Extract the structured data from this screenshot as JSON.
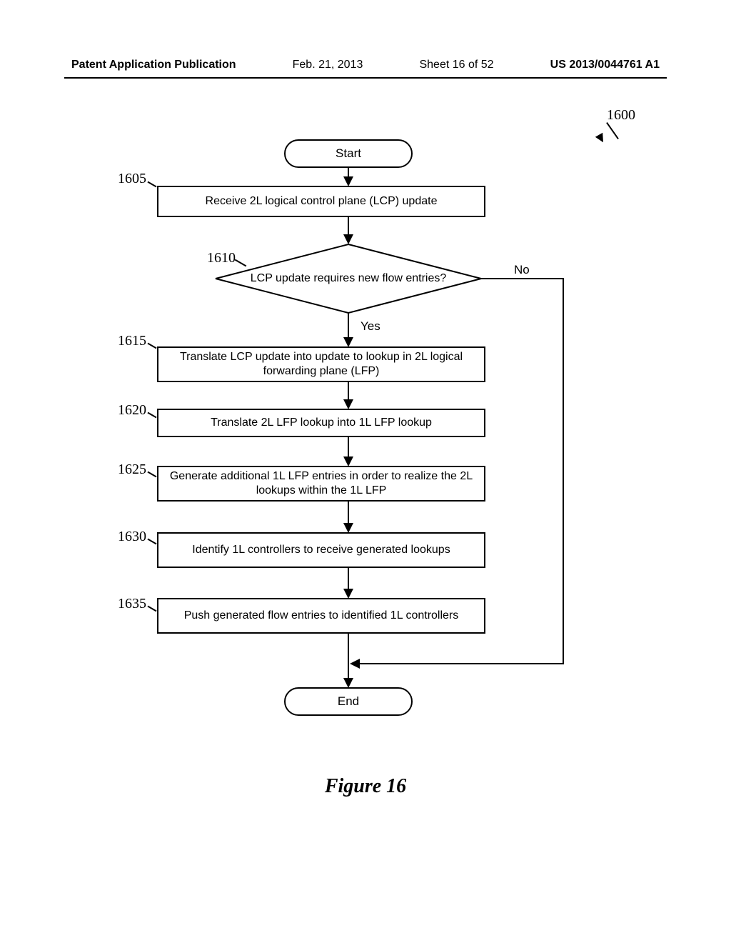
{
  "header": {
    "publication": "Patent Application Publication",
    "date": "Feb. 21, 2013",
    "sheet": "Sheet 16 of 52",
    "pub_id": "US 2013/0044761 A1"
  },
  "figure_caption": "Figure 16",
  "refs": {
    "r1600": "1600",
    "r1605": "1605",
    "r1610": "1610",
    "r1615": "1615",
    "r1620": "1620",
    "r1625": "1625",
    "r1630": "1630",
    "r1635": "1635"
  },
  "labels": {
    "start": "Start",
    "end": "End",
    "yes": "Yes",
    "no": "No"
  },
  "steps": {
    "s1605": "Receive 2L logical control plane (LCP) update",
    "s1610": "LCP update requires new flow entries?",
    "s1615": "Translate LCP update into update to lookup in 2L logical forwarding plane (LFP)",
    "s1620": "Translate 2L LFP lookup into 1L LFP lookup",
    "s1625": "Generate additional 1L LFP entries in order to realize the 2L lookups within the 1L LFP",
    "s1630": "Identify 1L controllers to receive generated lookups",
    "s1635": "Push generated flow entries to identified 1L controllers"
  },
  "chart_data": {
    "type": "flowchart",
    "title": "Figure 16",
    "ref": "1600",
    "nodes": [
      {
        "id": "start",
        "type": "terminator",
        "label": "Start"
      },
      {
        "id": "1605",
        "type": "process",
        "label": "Receive 2L logical control plane (LCP) update"
      },
      {
        "id": "1610",
        "type": "decision",
        "label": "LCP update requires new flow entries?"
      },
      {
        "id": "1615",
        "type": "process",
        "label": "Translate LCP update into update to lookup in 2L logical forwarding plane (LFP)"
      },
      {
        "id": "1620",
        "type": "process",
        "label": "Translate 2L LFP lookup into 1L LFP lookup"
      },
      {
        "id": "1625",
        "type": "process",
        "label": "Generate additional 1L LFP entries in order to realize the 2L lookups within the 1L LFP"
      },
      {
        "id": "1630",
        "type": "process",
        "label": "Identify 1L controllers to receive generated lookups"
      },
      {
        "id": "1635",
        "type": "process",
        "label": "Push generated flow entries to identified 1L controllers"
      },
      {
        "id": "end",
        "type": "terminator",
        "label": "End"
      }
    ],
    "edges": [
      {
        "from": "start",
        "to": "1605"
      },
      {
        "from": "1605",
        "to": "1610"
      },
      {
        "from": "1610",
        "to": "1615",
        "label": "Yes"
      },
      {
        "from": "1610",
        "to": "end",
        "label": "No"
      },
      {
        "from": "1615",
        "to": "1620"
      },
      {
        "from": "1620",
        "to": "1625"
      },
      {
        "from": "1625",
        "to": "1630"
      },
      {
        "from": "1630",
        "to": "1635"
      },
      {
        "from": "1635",
        "to": "end"
      }
    ]
  }
}
